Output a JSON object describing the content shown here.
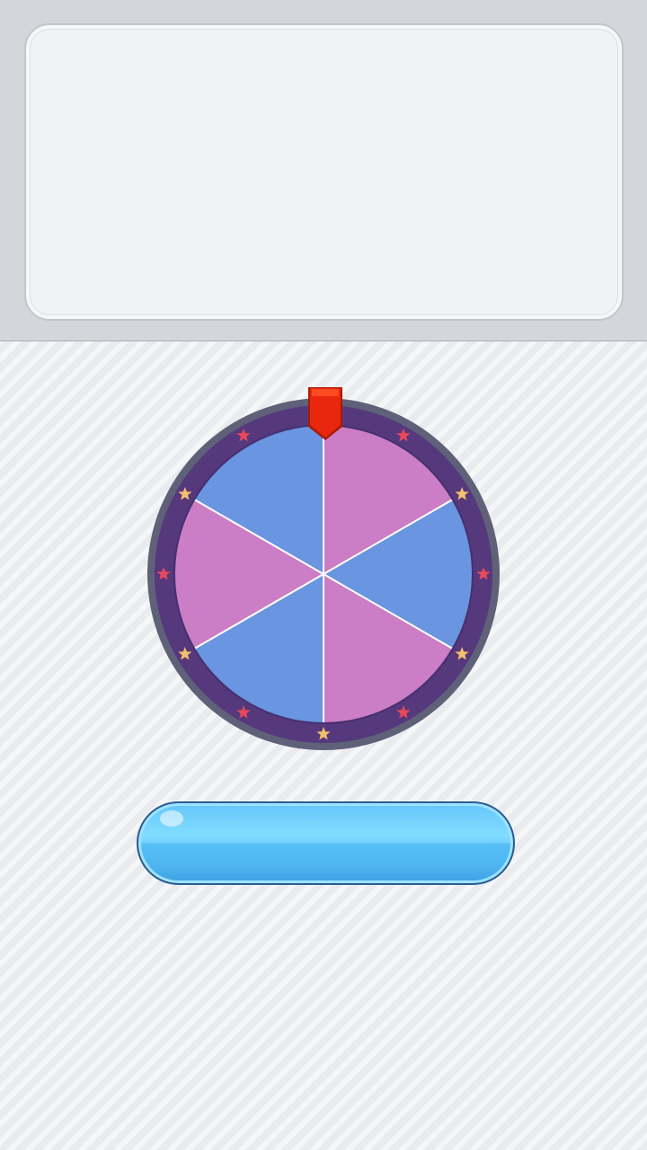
{
  "message_panel": {
    "text": ""
  },
  "wheel": {
    "segment_colors": [
      "#cb7dc6",
      "#6a95e0",
      "#cb7dc6",
      "#6a95e0",
      "#cb7dc6",
      "#6a95e0"
    ],
    "rim_color": "#56387d",
    "outer_ring_color": "#5f6179",
    "divider_color": "#ffffff",
    "star_colors": [
      "#f3c06b",
      "#e8495a"
    ],
    "pointer_color": "#e8270e",
    "pointer_icon": "pointer-flag-icon",
    "star_icon": "star-icon"
  },
  "spin_button": {
    "label": ""
  },
  "colors": {
    "top_area": "#d3d6da",
    "panel": "#f0f2f4",
    "button_blue": "#5cc3f8"
  }
}
